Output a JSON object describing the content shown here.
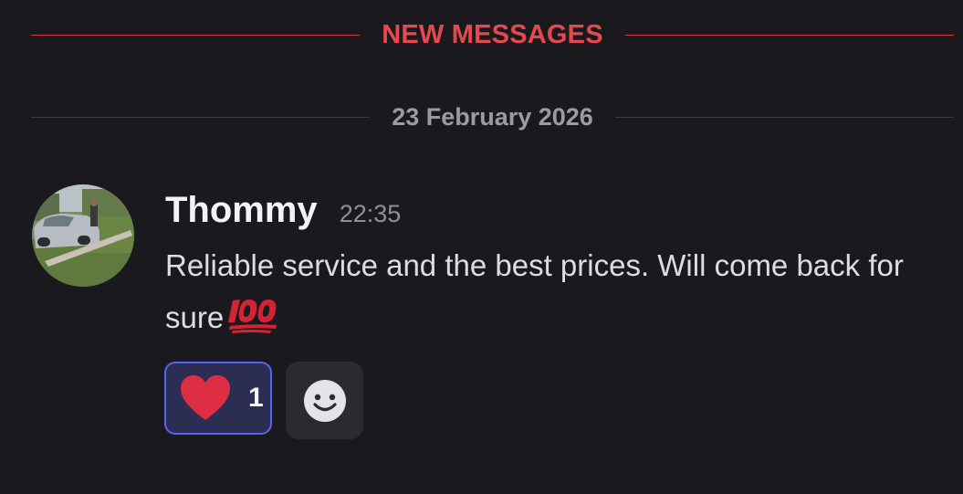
{
  "dividers": {
    "new_messages": "NEW MESSAGES",
    "date": "23 February 2026"
  },
  "message": {
    "author": "Thommy",
    "time": "22:35",
    "text": "Reliable service and the best prices. Will come back for sure",
    "emoji": "hundred-points-emoji"
  },
  "reactions": [
    {
      "emoji": "red-heart",
      "count": "1",
      "active": true
    }
  ],
  "add_reaction_icon": "smiley-add-reaction-icon",
  "colors": {
    "background": "#1a1a1e",
    "new_messages_red": "#e5484d",
    "reaction_accent": "#5865f2",
    "reaction_bg": "#2b2d52"
  }
}
